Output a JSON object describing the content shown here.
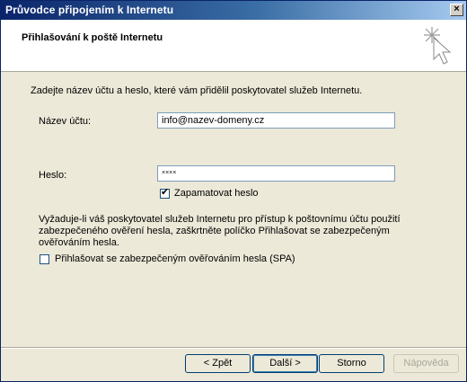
{
  "window": {
    "title": "Průvodce připojením k Internetu",
    "close_label": "×"
  },
  "header": {
    "title": "Přihlašování k poště Internetu"
  },
  "intro": "Zadejte název účtu a heslo, které vám přidělil poskytovatel služeb Internetu.",
  "account": {
    "label": "Název účtu:",
    "value": "info@nazev-domeny.cz"
  },
  "password": {
    "label": "Heslo:",
    "value": "××××"
  },
  "remember": {
    "label": "Zapamatovat heslo",
    "checked": true
  },
  "spa_info": {
    "line1": "Vyžaduje-li váš poskytovatel služeb Internetu pro přístup k poštovnímu účtu použití",
    "line2": "zabezpečeného ověření hesla, zaškrtněte políčko Přihlašovat se zabezpečeným",
    "line3": "ověřováním hesla."
  },
  "spa": {
    "label": "Přihlašovat se zabezpečeným ověřováním hesla (SPA)",
    "checked": false
  },
  "buttons": {
    "back": "< Zpět",
    "next": "Další >",
    "cancel": "Storno",
    "help": "Nápověda"
  }
}
